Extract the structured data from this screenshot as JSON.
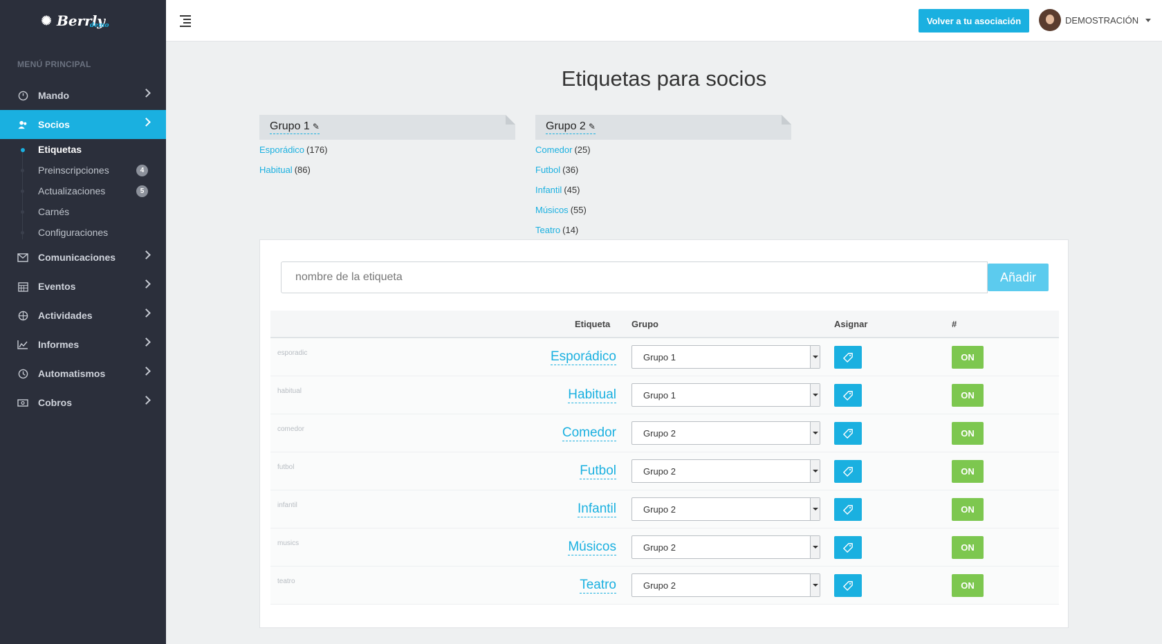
{
  "brand": {
    "name": "Berrly",
    "sub": "demo"
  },
  "sidebar": {
    "menu_title": "MENÚ PRINCIPAL",
    "items": [
      {
        "label": "Mando",
        "icon": "gauge-icon"
      },
      {
        "label": "Socios",
        "icon": "users-icon",
        "active": true
      },
      {
        "label": "Comunicaciones",
        "icon": "envelope-icon"
      },
      {
        "label": "Eventos",
        "icon": "calendar-icon"
      },
      {
        "label": "Actividades",
        "icon": "basketball-icon"
      },
      {
        "label": "Informes",
        "icon": "chart-icon"
      },
      {
        "label": "Automatismos",
        "icon": "clock-icon"
      },
      {
        "label": "Cobros",
        "icon": "money-icon"
      }
    ],
    "subitems": [
      {
        "label": "Etiquetas",
        "current": true
      },
      {
        "label": "Preinscripciones",
        "badge": "4"
      },
      {
        "label": "Actualizaciones",
        "badge": "5"
      },
      {
        "label": "Carnés"
      },
      {
        "label": "Configuraciones"
      }
    ]
  },
  "header": {
    "back_button": "Volver a tu asociación",
    "user_name": "DEMOSTRACIÓN"
  },
  "page": {
    "title": "Etiquetas para socios"
  },
  "groups": [
    {
      "name": "Grupo 1",
      "tags": [
        {
          "name": "Esporádico",
          "count": "(176)"
        },
        {
          "name": "Habitual",
          "count": "(86)"
        }
      ]
    },
    {
      "name": "Grupo 2",
      "tags": [
        {
          "name": "Comedor",
          "count": "(25)"
        },
        {
          "name": "Futbol",
          "count": "(36)"
        },
        {
          "name": "Infantil",
          "count": "(45)"
        },
        {
          "name": "Músicos",
          "count": "(55)"
        },
        {
          "name": "Teatro",
          "count": "(14)"
        }
      ]
    }
  ],
  "add_form": {
    "placeholder": "nombre de la etiqueta",
    "button": "Añadir"
  },
  "table": {
    "headers": {
      "tag": "Etiqueta",
      "group": "Grupo",
      "assign": "Asignar",
      "hash": "#"
    },
    "rows": [
      {
        "slug": "esporadic",
        "name": "Esporádico",
        "group": "Grupo 1",
        "status": "ON"
      },
      {
        "slug": "habitual",
        "name": "Habitual",
        "group": "Grupo 1",
        "status": "ON"
      },
      {
        "slug": "comedor",
        "name": "Comedor",
        "group": "Grupo 2",
        "status": "ON"
      },
      {
        "slug": "futbol",
        "name": "Futbol",
        "group": "Grupo 2",
        "status": "ON"
      },
      {
        "slug": "infantil",
        "name": "Infantil",
        "group": "Grupo 2",
        "status": "ON"
      },
      {
        "slug": "musics",
        "name": "Músicos",
        "group": "Grupo 2",
        "status": "ON"
      },
      {
        "slug": "teatro",
        "name": "Teatro",
        "group": "Grupo 2",
        "status": "ON"
      }
    ]
  },
  "colors": {
    "accent": "#1ab0e0",
    "sidebar": "#2b2f3b",
    "on": "#7dc74f"
  }
}
